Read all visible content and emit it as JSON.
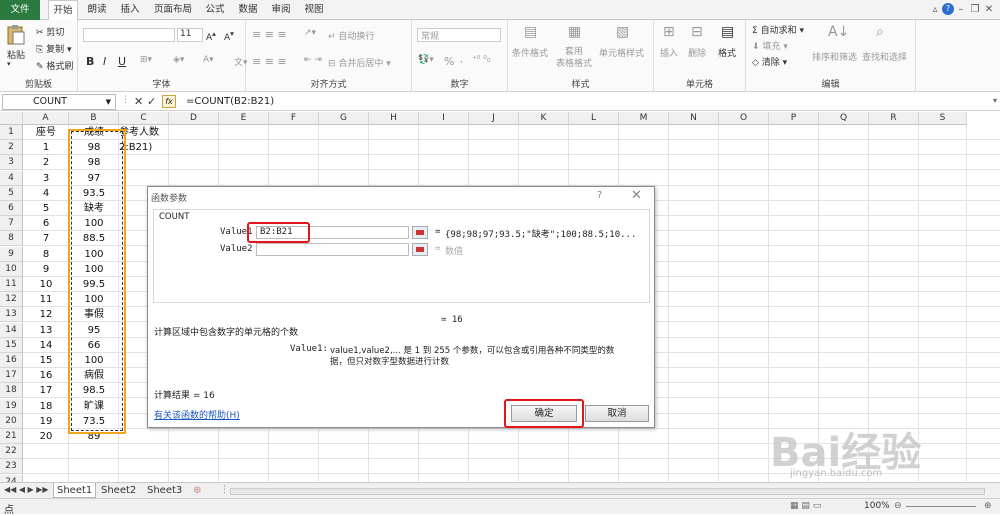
{
  "menu": {
    "tabs": [
      "文件",
      "开始",
      "朗读",
      "插入",
      "页面布局",
      "公式",
      "数据",
      "审阅",
      "视图"
    ],
    "active": "开始"
  },
  "ribbon": {
    "clipboard": {
      "label": "剪贴板",
      "paste": "粘贴",
      "cut": "剪切",
      "copy": "复制",
      "format_painter": "格式刷"
    },
    "font": {
      "label": "字体",
      "size": "11",
      "bold": "B",
      "italic": "I",
      "underline": "U"
    },
    "alignment": {
      "label": "对齐方式",
      "wrap": "自动换行",
      "merge": "合并后居中"
    },
    "number": {
      "label": "数字",
      "format": "常规",
      "percent": "%"
    },
    "styles": {
      "label": "样式",
      "conditional": "条件格式",
      "table": "套用\n表格格式",
      "cell_styles": "单元格样式"
    },
    "cells": {
      "label": "单元格",
      "insert": "插入",
      "delete": "删除",
      "format": "格式"
    },
    "editing": {
      "label": "编辑",
      "autosum": "自动求和",
      "fill": "填充",
      "clear": "清除",
      "sort": "排序和筛选",
      "find": "查找和选择"
    }
  },
  "formula_bar": {
    "name_box": "COUNT",
    "fx": "fx",
    "formula": "=COUNT(B2:B21)"
  },
  "grid": {
    "columns": [
      "A",
      "B",
      "C",
      "D",
      "E",
      "F",
      "G",
      "H",
      "I",
      "J",
      "K",
      "L",
      "M",
      "N",
      "O",
      "P",
      "Q",
      "R",
      "S"
    ],
    "rows": [
      "1",
      "2",
      "3",
      "4",
      "5",
      "6",
      "7",
      "8",
      "9",
      "10",
      "11",
      "12",
      "13",
      "14",
      "15",
      "16",
      "17",
      "18",
      "19",
      "20",
      "21",
      "22",
      "23",
      "24"
    ],
    "header_a": "座号",
    "header_b": "成绩",
    "header_c": "参考人数",
    "c2_text": "2:B21)",
    "col_a": [
      "1",
      "2",
      "3",
      "4",
      "5",
      "6",
      "7",
      "8",
      "9",
      "10",
      "11",
      "12",
      "13",
      "14",
      "15",
      "16",
      "17",
      "18",
      "19",
      "20"
    ],
    "col_b": [
      "98",
      "98",
      "97",
      "93.5",
      "缺考",
      "100",
      "88.5",
      "100",
      "100",
      "99.5",
      "100",
      "事假",
      "95",
      "66",
      "100",
      "病假",
      "98.5",
      "旷课",
      "73.5",
      "89"
    ]
  },
  "dialog": {
    "title": "函数参数",
    "help_icon": "?",
    "close_icon": "✕",
    "function_name": "COUNT",
    "arg1_label": "Value1",
    "arg1_value": "B2:B21",
    "arg1_result": "{98;98;97;93.5;\"缺考\";100;88.5;10...",
    "arg2_label": "Value2",
    "arg2_placeholder": "数值",
    "eq": "=",
    "total": "= 16",
    "description": "计算区域中包含数字的单元格的个数",
    "param_name": "Value1:",
    "param_desc_1": "value1,value2,... 是 1 到 255 个参数，可以包含或引用各种不同类型的数",
    "param_desc_2": "据，但只对数字型数据进行计数",
    "result_line": "计算结果 =  16",
    "help_link": "有关该函数的帮助(H)",
    "ok": "确定",
    "cancel": "取消"
  },
  "sheets": {
    "tabs": [
      "Sheet1",
      "Sheet2",
      "Sheet3"
    ]
  },
  "status": {
    "mode": "点",
    "zoom": "100%"
  },
  "watermark": {
    "brand": "Bai经验",
    "url": "jingyan.baidu.com"
  }
}
